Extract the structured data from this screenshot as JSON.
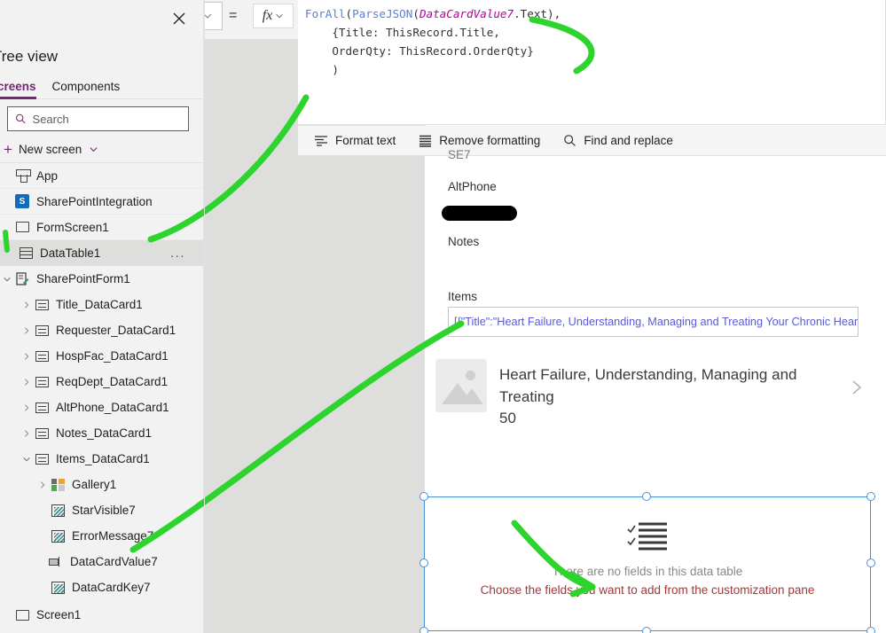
{
  "app": {
    "accent_color": "#742774",
    "selection_color": "#4a90d9",
    "annotation_color": "#3ddc3d"
  },
  "property_bar": {
    "property_dropdown_value": "",
    "equals_sign": "=",
    "fx_label": "fx"
  },
  "formula_bar": {
    "lines": [
      {
        "segments": [
          {
            "text": "ForAll",
            "kind": "fn"
          },
          {
            "text": "(",
            "kind": "plain"
          },
          {
            "text": "ParseJSON",
            "kind": "fn"
          },
          {
            "text": "(",
            "kind": "plain"
          },
          {
            "text": "DataCardValue7",
            "kind": "var"
          },
          {
            "text": ".Text),",
            "kind": "plain"
          }
        ]
      },
      {
        "segments": [
          {
            "text": "    {Title: ThisRecord.Title,",
            "kind": "plain"
          }
        ]
      },
      {
        "segments": [
          {
            "text": "    OrderQty: ThisRecord.OrderQty}",
            "kind": "plain"
          }
        ]
      },
      {
        "segments": [
          {
            "text": "    )",
            "kind": "plain"
          }
        ]
      }
    ],
    "plain_text": "ForAll(ParseJSON(DataCardValue7.Text),\n    {Title: ThisRecord.Title,\n    OrderQty: ThisRecord.OrderQty}\n    )"
  },
  "format_toolbar": {
    "items": [
      {
        "label": "Format text",
        "icon": "format-text-icon"
      },
      {
        "label": "Remove formatting",
        "icon": "remove-formatting-icon"
      },
      {
        "label": "Find and replace",
        "icon": "search-icon"
      }
    ]
  },
  "tree_view": {
    "title": "Tree view",
    "close_icon": "close-icon",
    "tabs": [
      {
        "label": "Screens",
        "active": true
      },
      {
        "label": "Components",
        "active": false
      }
    ],
    "search": {
      "placeholder": "Search",
      "value": "",
      "icon": "search-icon"
    },
    "new_screen": {
      "label": "New screen",
      "plus_icon": "plus-icon",
      "chevron_icon": "chevron-down-icon"
    },
    "items": [
      {
        "label": "App",
        "icon": "app-icon",
        "indent": 0,
        "chevron": "none",
        "selected": false
      },
      {
        "label": "SharePointIntegration",
        "icon": "sharepoint-icon",
        "indent": 0,
        "chevron": "none",
        "selected": false
      },
      {
        "label": "FormScreen1",
        "icon": "screen-icon",
        "indent": 0,
        "chevron": "none",
        "selected": false
      },
      {
        "label": "DataTable1",
        "icon": "datatable-icon",
        "indent": 1,
        "chevron": "none",
        "selected": true,
        "overflow": "..."
      },
      {
        "label": "SharePointForm1",
        "icon": "form-icon",
        "indent": 0,
        "chevron": "down",
        "selected": false
      },
      {
        "label": "Title_DataCard1",
        "icon": "datacard-icon",
        "indent": 2,
        "chevron": "right",
        "selected": false
      },
      {
        "label": "Requester_DataCard1",
        "icon": "datacard-icon",
        "indent": 2,
        "chevron": "right",
        "selected": false
      },
      {
        "label": "HospFac_DataCard1",
        "icon": "datacard-icon",
        "indent": 2,
        "chevron": "right",
        "selected": false
      },
      {
        "label": "ReqDept_DataCard1",
        "icon": "datacard-icon",
        "indent": 2,
        "chevron": "right",
        "selected": false
      },
      {
        "label": "AltPhone_DataCard1",
        "icon": "datacard-icon",
        "indent": 2,
        "chevron": "right",
        "selected": false
      },
      {
        "label": "Notes_DataCard1",
        "icon": "datacard-icon",
        "indent": 2,
        "chevron": "right",
        "selected": false
      },
      {
        "label": "Items_DataCard1",
        "icon": "datacard-icon",
        "indent": 2,
        "chevron": "down",
        "selected": false
      },
      {
        "label": "Gallery1",
        "icon": "gallery-icon",
        "indent": 3,
        "chevron": "right",
        "selected": false
      },
      {
        "label": "StarVisible7",
        "icon": "label-icon",
        "indent": 3,
        "chevron": "none",
        "selected": false
      },
      {
        "label": "ErrorMessage7",
        "icon": "label-icon",
        "indent": 3,
        "chevron": "none",
        "selected": false
      },
      {
        "label": "DataCardValue7",
        "icon": "text-input-icon",
        "indent": 3,
        "chevron": "none",
        "selected": false
      },
      {
        "label": "DataCardKey7",
        "icon": "label-icon",
        "indent": 3,
        "chevron": "none",
        "selected": false
      },
      {
        "label": "Screen1",
        "icon": "screen-icon",
        "indent": 0,
        "chevron": "none",
        "selected": false
      }
    ]
  },
  "canvas": {
    "partial_label_top": "SE7",
    "fields": [
      {
        "label": "AltPhone"
      },
      {
        "label": "Notes"
      },
      {
        "label": "Items"
      }
    ],
    "redacted_value": "",
    "items_input": {
      "value": "[{\"Title\":\"Heart Failure, Understanding, Managing and Treating Your Chronic Heart Condition"
    },
    "gallery_item": {
      "thumbnail_icon": "image-placeholder-icon",
      "title": "Heart Failure, Understanding, Managing and Treating",
      "subtitle": "50",
      "chevron_icon": "chevron-right-icon"
    },
    "data_table": {
      "empty_icon": "checklist-icon",
      "empty_message": "There are no fields in this data table",
      "empty_action": "Choose the fields you want to add from the customization pane",
      "selected": true
    }
  }
}
